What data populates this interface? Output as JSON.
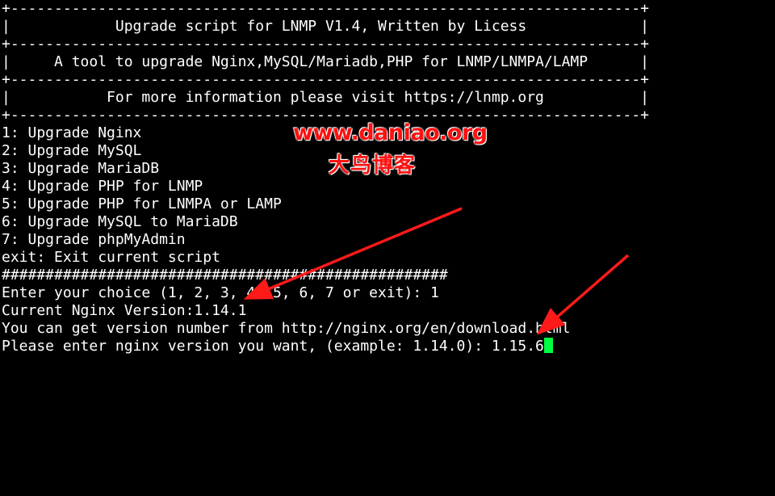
{
  "terminal": {
    "lines": [
      "+------------------------------------------------------------------------+",
      "|            Upgrade script for LNMP V1.4, Written by Licess             |",
      "+------------------------------------------------------------------------+",
      "|     A tool to upgrade Nginx,MySQL/Mariadb,PHP for LNMP/LNMPA/LAMP      |",
      "+------------------------------------------------------------------------+",
      "|           For more information please visit https://lnmp.org           |",
      "+------------------------------------------------------------------------+",
      "1: Upgrade Nginx",
      "2: Upgrade MySQL",
      "3: Upgrade MariaDB",
      "4: Upgrade PHP for LNMP",
      "5: Upgrade PHP for LNMPA or LAMP",
      "6: Upgrade MySQL to MariaDB",
      "7: Upgrade phpMyAdmin",
      "exit: Exit current script",
      "###################################################",
      "Enter your choice (1, 2, 3, 4, 5, 6, 7 or exit): 1",
      "Current Nginx Version:1.14.1",
      "You can get version number from http://nginx.org/en/download.html",
      "Please enter nginx version you want, (example: 1.14.0): 1.15.6"
    ],
    "cursor_color": "#00ff40",
    "background": "#000000",
    "foreground": "#ffffff"
  },
  "watermark": {
    "url": "www.daniao.org",
    "name": "大鸟博客",
    "color": "#ff1010"
  },
  "annotations": {
    "arrow_color": "#ff1a1a"
  }
}
